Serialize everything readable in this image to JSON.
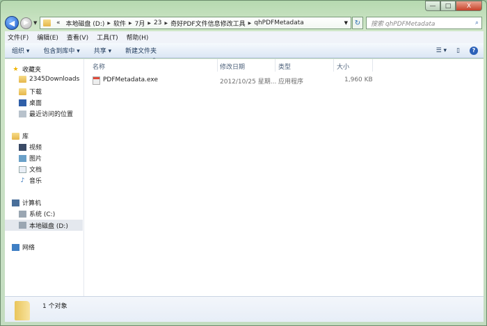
{
  "window": {
    "minimize": "—",
    "maximize": "□",
    "close": "X"
  },
  "address": {
    "segments": [
      "«",
      "本地磁盘 (D:)",
      "软件",
      "7月",
      "23",
      "奇好PDF文件信息修改工具",
      "qhPDFMetadata"
    ]
  },
  "search": {
    "placeholder": "搜索 qhPDFMetadata"
  },
  "menu": [
    "文件(F)",
    "编辑(E)",
    "查看(V)",
    "工具(T)",
    "帮助(H)"
  ],
  "toolbar": {
    "organize": "组织 ▾",
    "include": "包含到库中 ▾",
    "share": "共享 ▾",
    "new_folder": "新建文件夹"
  },
  "sidebar": {
    "favorites": "收藏夹",
    "fav_items": [
      "2345Downloads",
      "下载",
      "桌面",
      "最近访问的位置"
    ],
    "libraries": "库",
    "lib_items": [
      "视频",
      "图片",
      "文档",
      "音乐"
    ],
    "computer": "计算机",
    "comp_items": [
      "系统 (C:)",
      "本地磁盘 (D:)"
    ],
    "network": "网络"
  },
  "columns": [
    "名称",
    "修改日期",
    "类型",
    "大小"
  ],
  "files": [
    {
      "name": "PDFMetadata.exe",
      "date": "2012/10/25 星期...",
      "type": "应用程序",
      "size": "1,960 KB"
    }
  ],
  "status": {
    "count": "1 个对象"
  }
}
